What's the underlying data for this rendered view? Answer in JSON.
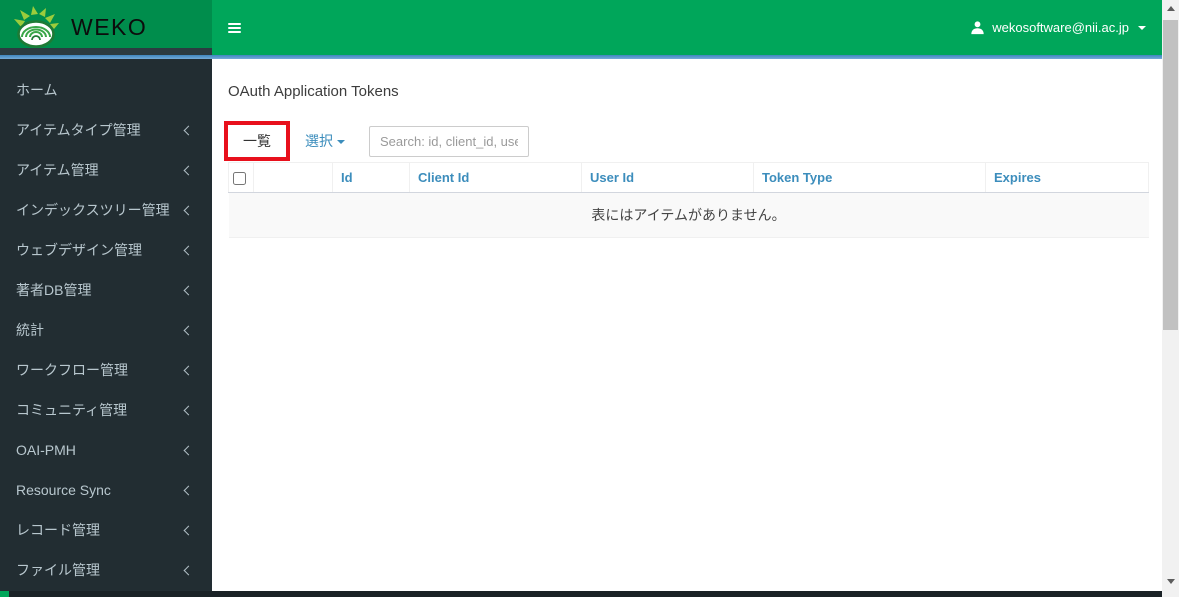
{
  "header": {
    "brand": "WEKO",
    "user_email": "wekosoftware@nii.ac.jp"
  },
  "sidebar": {
    "items": [
      {
        "label": "ホーム",
        "has_submenu": false
      },
      {
        "label": "アイテムタイプ管理",
        "has_submenu": true
      },
      {
        "label": "アイテム管理",
        "has_submenu": true
      },
      {
        "label": "インデックスツリー管理",
        "has_submenu": true
      },
      {
        "label": "ウェブデザイン管理",
        "has_submenu": true
      },
      {
        "label": "著者DB管理",
        "has_submenu": true
      },
      {
        "label": "統計",
        "has_submenu": true
      },
      {
        "label": "ワークフロー管理",
        "has_submenu": true
      },
      {
        "label": "コミュニティ管理",
        "has_submenu": true
      },
      {
        "label": "OAI-PMH",
        "has_submenu": true
      },
      {
        "label": "Resource Sync",
        "has_submenu": true
      },
      {
        "label": "レコード管理",
        "has_submenu": true
      },
      {
        "label": "ファイル管理",
        "has_submenu": true
      }
    ]
  },
  "main": {
    "title": "OAuth Application Tokens",
    "toolbar": {
      "list_label": "一覧",
      "select_label": "選択",
      "search_placeholder": "Search: id, client_id, user_"
    },
    "table": {
      "columns": [
        "Id",
        "Client Id",
        "User Id",
        "Token Type",
        "Expires"
      ],
      "empty_message": "表にはアイテムがありません。"
    }
  },
  "colors": {
    "navbar_green": "#00a65a",
    "logo_green": "#008d4c",
    "header_accent_blue": "#4a90c8",
    "sidebar_bg": "#222d32",
    "sidebar_text": "#b8c7ce",
    "link_blue": "#3c8dbc",
    "table_header_text": "#3c8dbc",
    "annotation_red": "#e8101c",
    "empty_row_bg": "#f9f9f9"
  }
}
